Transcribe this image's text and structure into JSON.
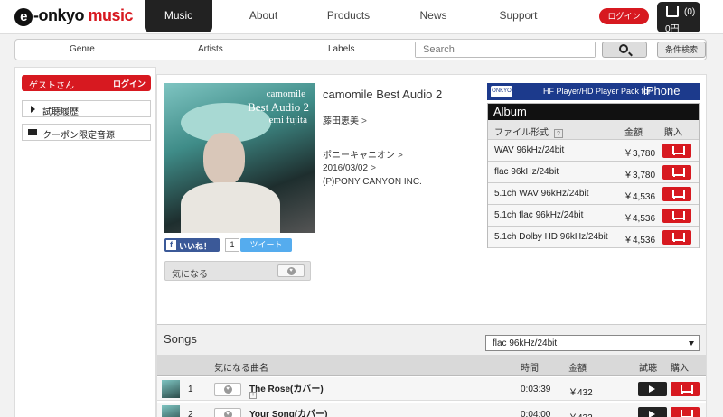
{
  "header": {
    "logo_prefix": "e",
    "logo_brand": "-onkyo ",
    "logo_music": "music",
    "nav": [
      "Music",
      "About",
      "Products",
      "News",
      "Support"
    ],
    "login": "ログイン",
    "cart_count": "(0)",
    "cart_total": "0円"
  },
  "subbar": {
    "items": [
      "Genre",
      "Artists",
      "Labels"
    ],
    "search_placeholder": "Search",
    "advanced_search": "条件検索"
  },
  "sidebar": {
    "guest": "ゲストさん",
    "guest_login": "ログイン",
    "history": "試聴履歴",
    "coupon": "クーポン限定音源"
  },
  "album": {
    "cover_title_line1": "camomile",
    "cover_title_line2": "Best Audio 2",
    "cover_artist": "emi fujita",
    "title": "camomile Best Audio 2",
    "artist": "藤田恵美",
    "label": "ポニーキャニオン",
    "date": "2016/03/02",
    "copyright": "(P)PONY CANYON INC."
  },
  "social": {
    "like": "いいね！",
    "like_count": "1",
    "tweet": "ツイート",
    "favorite": "気になる"
  },
  "hf_banner": {
    "badge": "ONKYO",
    "text": "HF Player/HD Player Pack for",
    "device": "iPhone"
  },
  "purchase": {
    "heading": "Album",
    "col_format": "ファイル形式",
    "col_help": "?",
    "col_price": "金額",
    "col_buy": "購入",
    "formats": [
      {
        "name": "WAV 96kHz/24bit",
        "price": "￥3,780"
      },
      {
        "name": "flac 96kHz/24bit",
        "price": "￥3,780"
      },
      {
        "name": "5.1ch WAV 96kHz/24bit",
        "price": "￥4,536"
      },
      {
        "name": "5.1ch flac 96kHz/24bit",
        "price": "￥4,536"
      },
      {
        "name": "5.1ch Dolby HD 96kHz/24bit",
        "price": "￥4,536"
      }
    ]
  },
  "songs": {
    "title": "Songs",
    "selected_format": "flac 96kHz/24bit",
    "col_favorite_song": "気になる曲名",
    "col_time": "時間",
    "col_price": "金額",
    "col_listen": "試聴",
    "col_buy": "購入",
    "tracks": [
      {
        "num": "1",
        "name": "The Rose(カバー)",
        "plus": "+",
        "time": "0:03:39",
        "price": "￥432"
      },
      {
        "num": "2",
        "name": "Your Song(カバー)",
        "plus": "+",
        "time": "0:04:00",
        "price": "￥432"
      }
    ]
  }
}
